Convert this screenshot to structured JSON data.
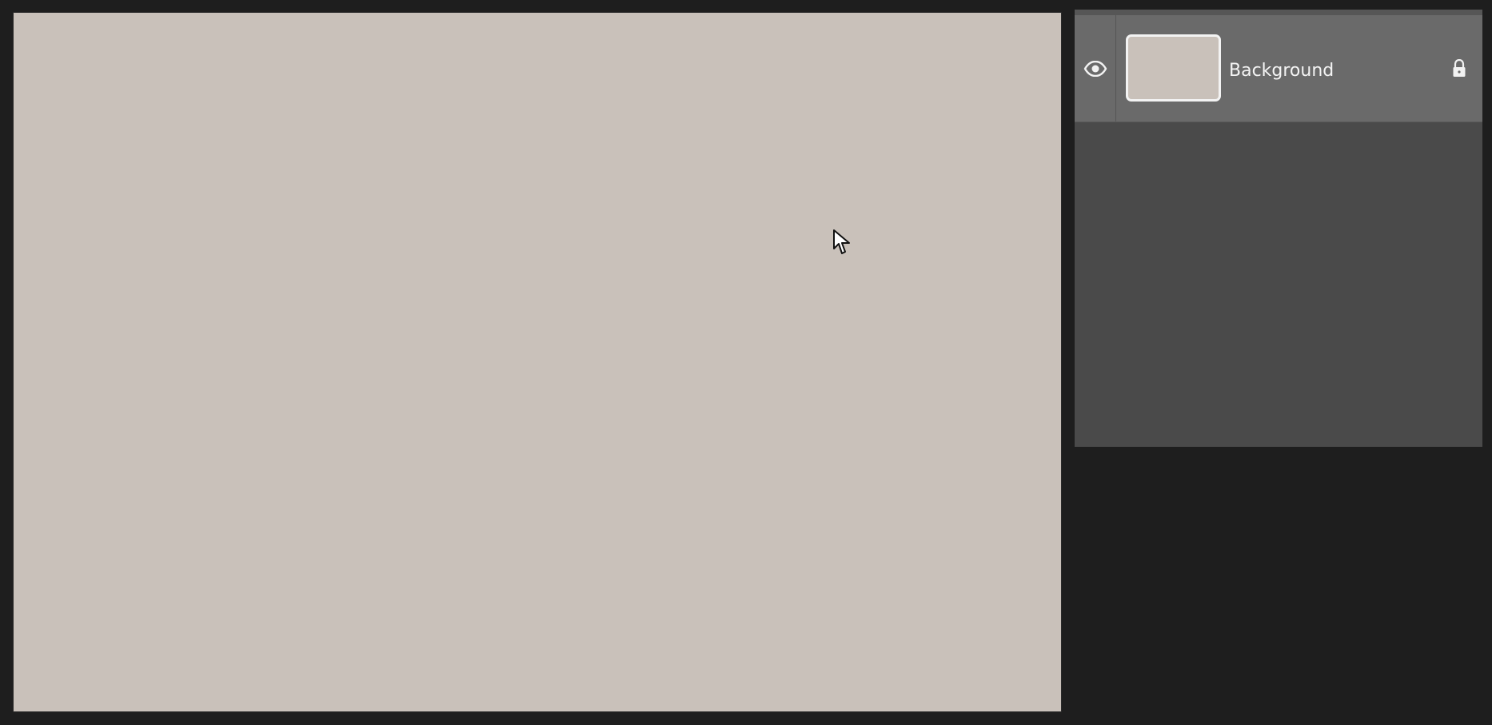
{
  "colors": {
    "app_background": "#1e1e1e",
    "canvas_fill": "#c9c1ba",
    "panel_background": "#4a4a4a",
    "selected_layer_row": "#6a6a6a",
    "thumbnail_border": "#f3f3f3"
  },
  "canvas": {
    "fill_color": "#c9c1ba"
  },
  "cursor": {
    "icon": "arrow-cursor"
  },
  "layers_panel": {
    "layers": [
      {
        "name": "Background",
        "visible": true,
        "locked": true,
        "selected": true,
        "visibility_icon": "eye-icon",
        "lock_icon": "lock-icon"
      }
    ]
  }
}
